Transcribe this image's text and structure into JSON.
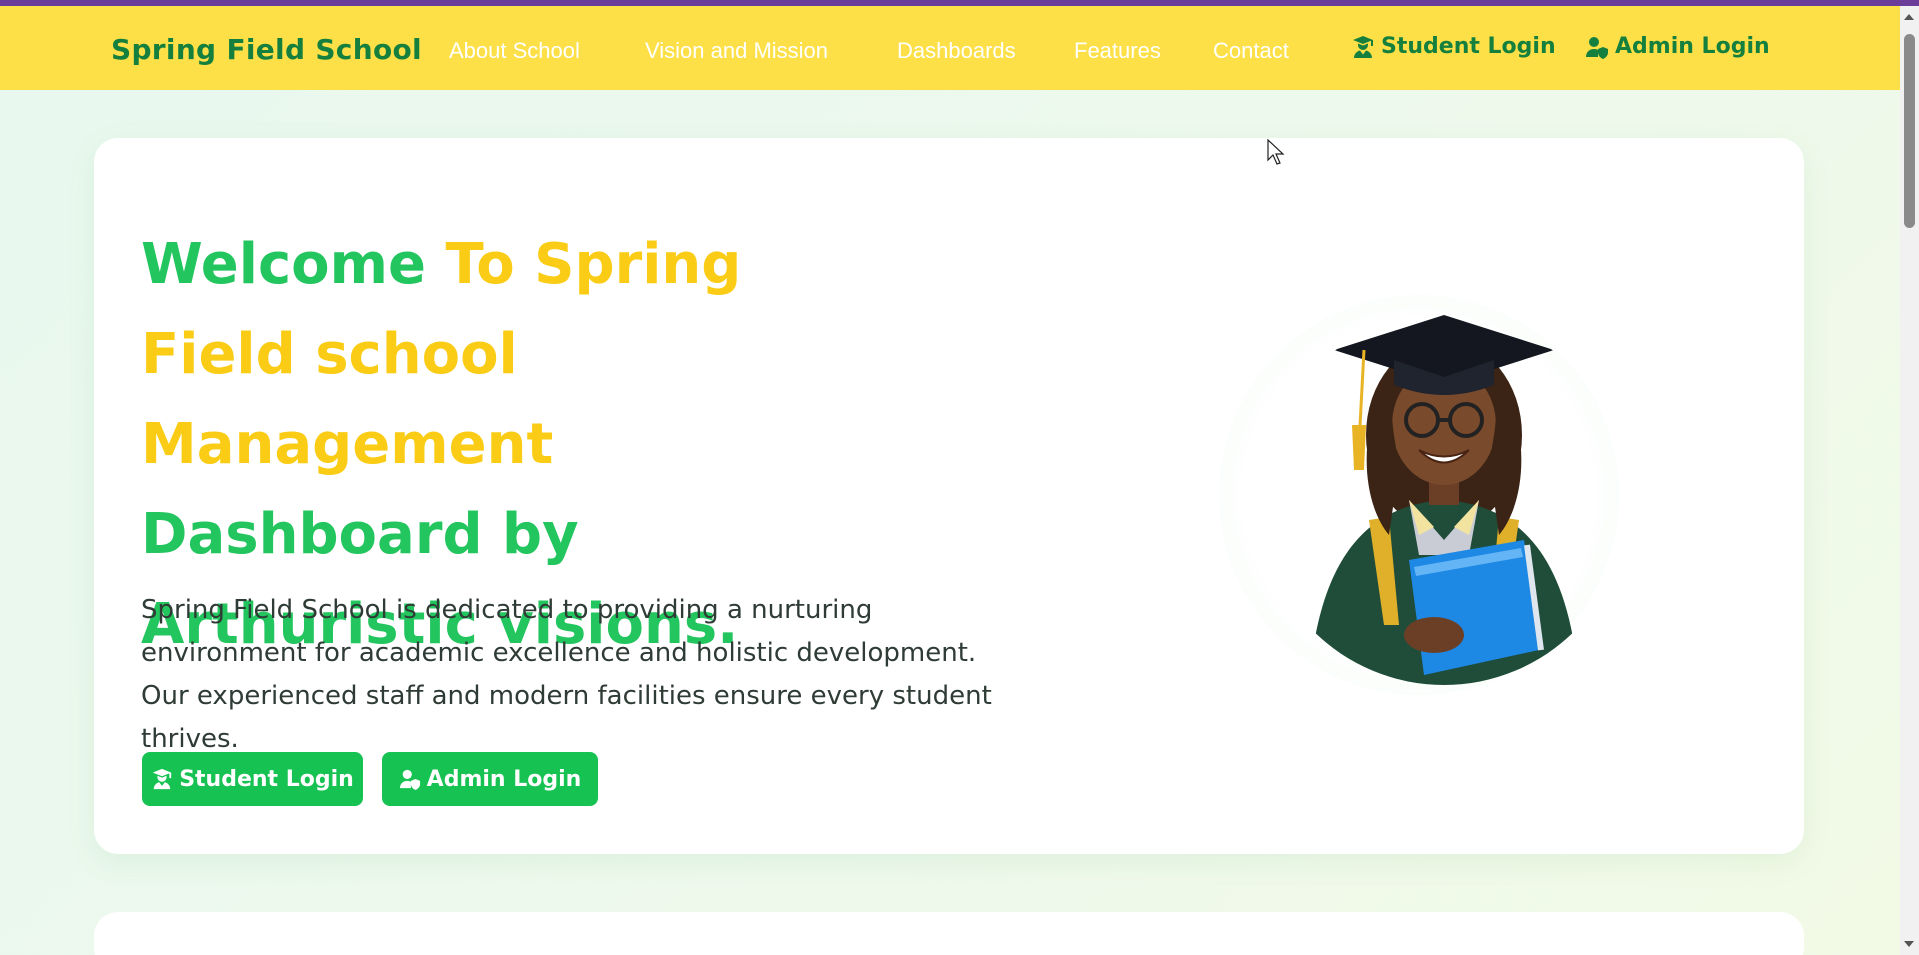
{
  "navbar": {
    "brand": "Spring Field School",
    "links": [
      "About School",
      "Vision and Mission",
      "Dashboards",
      "Features",
      "Contact"
    ],
    "student_login": "Student Login",
    "admin_login": "Admin Login"
  },
  "hero": {
    "title_part1": "Welcome ",
    "title_part2": "To Spring Field school Management",
    "title_part3": " Dashboard by Arthuristic visions.",
    "description": "Spring Field School is dedicated to providing a nurturing environment for academic excellence and holistic development. Our experienced staff and modern facilities ensure every student thrives.",
    "student_button": "Student Login",
    "admin_button": "Admin Login"
  },
  "colors": {
    "nav_background": "#fde047",
    "brand_green": "#15803d",
    "title_green": "#22c55e",
    "title_yellow": "#facc15",
    "button_green": "#16c252",
    "top_strip": "#6a3d9a"
  },
  "icons": {
    "student": "graduate-user-icon",
    "admin": "user-shield-icon"
  }
}
